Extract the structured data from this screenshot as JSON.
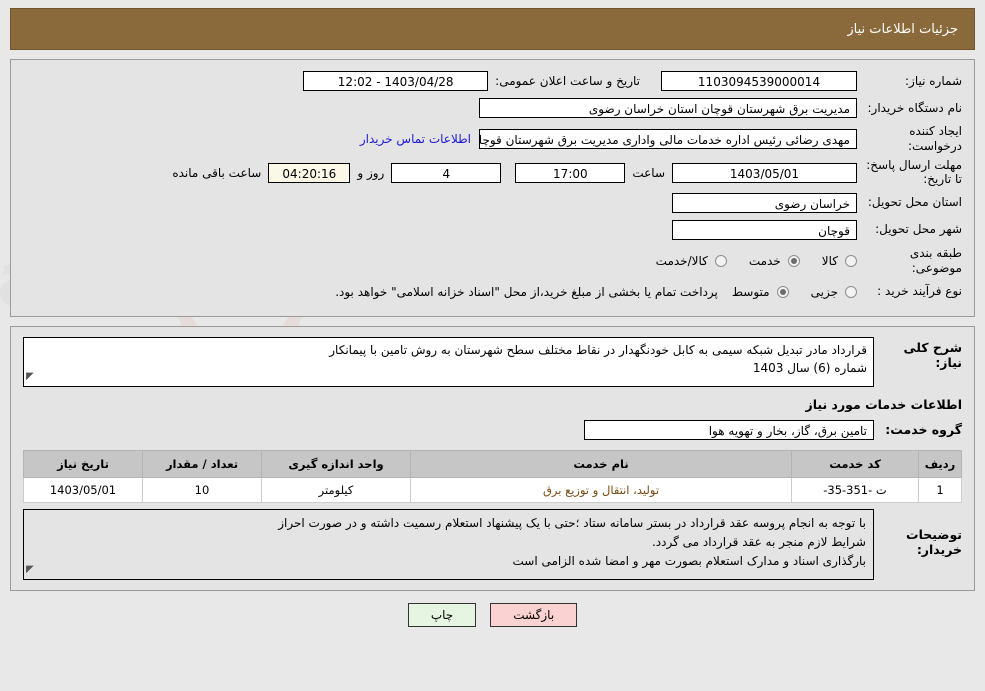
{
  "header": {
    "title": "جزئیات اطلاعات نیاز"
  },
  "form": {
    "need_number_label": "شماره نیاز:",
    "need_number_value": "1103094539000014",
    "announce_datetime_label": "تاریخ و ساعت اعلان عمومی:",
    "announce_datetime_value": "1403/04/28 - 12:02",
    "buyer_org_label": "نام دستگاه خریدار:",
    "buyer_org_value": "مدیریت برق شهرستان قوچان استان خراسان رضوی",
    "creator_label": "ایجاد کننده درخواست:",
    "creator_value": "مهدی رضائی رئیس اداره خدمات مالی واداری مدیریت برق شهرستان قوچان است",
    "contact_link": "اطلاعات تماس خریدار",
    "deadline_label": "مهلت ارسال پاسخ: تا تاریخ:",
    "deadline_date": "1403/05/01",
    "hour_label": "ساعت",
    "deadline_time": "17:00",
    "days_remaining": "4",
    "days_label": "روز و",
    "clock_remaining": "04:20:16",
    "hours_remaining_label": "ساعت باقی مانده",
    "province_label": "استان محل تحویل:",
    "province_value": "خراسان رضوی",
    "city_label": "شهر محل تحویل:",
    "city_value": "قوچان",
    "category_label": "طبقه بندی موضوعی:",
    "category_options": [
      {
        "label": "کالا",
        "selected": false
      },
      {
        "label": "خدمت",
        "selected": true
      },
      {
        "label": "کالا/خدمت",
        "selected": false
      }
    ],
    "process_label": "نوع فرآیند خرید :",
    "process_options": [
      {
        "label": "جزیی",
        "selected": false
      },
      {
        "label": "متوسط",
        "selected": true
      }
    ],
    "payment_note": "پرداخت تمام یا بخشی از مبلغ خرید،از محل \"اسناد خزانه اسلامی\" خواهد بود."
  },
  "description": {
    "label": "شرح کلی نیاز:",
    "line1": "قرارداد مادر تبدیل شبکه سیمی به کابل خودنگهدار در نقاط مختلف سطح شهرستان به روش تامین با پیمانکار",
    "line2": "شماره (6) سال 1403"
  },
  "services": {
    "section_title": "اطلاعات خدمات مورد نیاز",
    "group_label": "گروه خدمت:",
    "group_value": "تامین برق، گاز، بخار و تهویه هوا",
    "columns": [
      "ردیف",
      "کد خدمت",
      "نام خدمت",
      "واحد اندازه گیری",
      "تعداد / مقدار",
      "تاریخ نیاز"
    ],
    "rows": [
      {
        "radif": "1",
        "code": "ت -351-35-",
        "name": "تولید، انتقال و توزیع برق",
        "unit": "کیلومتر",
        "qty": "10",
        "date": "1403/05/01"
      }
    ]
  },
  "buyer_notes": {
    "label": "توضیحات خریدار:",
    "line1": "با توجه به انجام پروسه عقد قرارداد در بستر سامانه ستاد ؛حتی با یک پیشنهاد استعلام رسمیت داشته و در صورت احراز",
    "line2": "شرایط لازم منجر به عقد قرارداد می گردد.",
    "line3": "بارگذاری اسناد و مدارک استعلام بصورت مهر و امضا شده الزامی است"
  },
  "footer": {
    "back_label": "بازگشت",
    "print_label": "چاپ"
  }
}
